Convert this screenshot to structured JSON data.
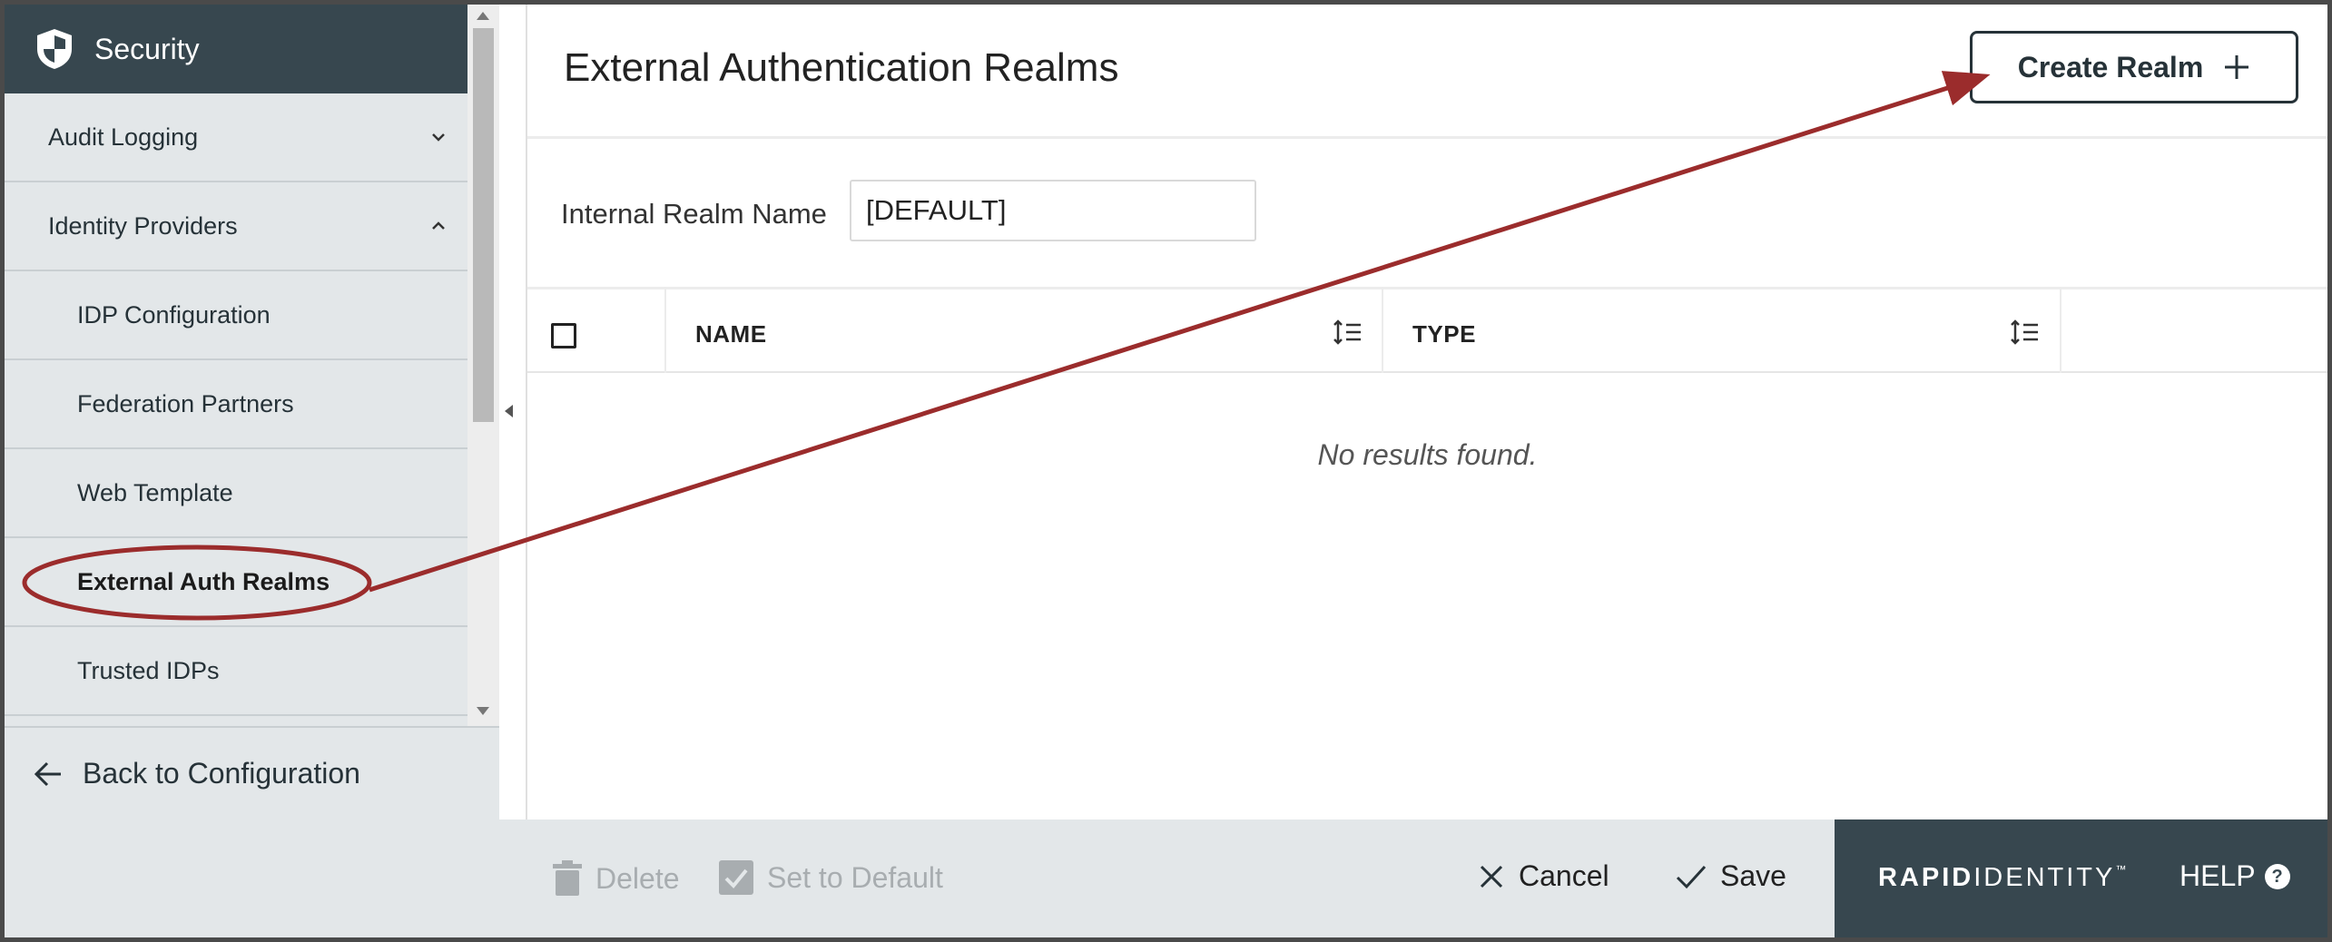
{
  "sidebar": {
    "header_title": "Security",
    "items": [
      {
        "label": "Audit Logging",
        "level": 1,
        "chevron": "down"
      },
      {
        "label": "Identity Providers",
        "level": 1,
        "chevron": "up"
      },
      {
        "label": "IDP Configuration",
        "level": 2
      },
      {
        "label": "Federation Partners",
        "level": 2
      },
      {
        "label": "Web Template",
        "level": 2
      },
      {
        "label": "External Auth Realms",
        "level": 2,
        "active": true
      },
      {
        "label": "Trusted IDPs",
        "level": 2
      }
    ],
    "back_label": "Back to Configuration"
  },
  "main": {
    "title": "External Authentication Realms",
    "create_button_label": "Create Realm",
    "internal_realm": {
      "label": "Internal Realm Name",
      "value": "[DEFAULT]"
    },
    "table": {
      "columns": [
        "NAME",
        "TYPE"
      ],
      "rows": [],
      "empty_message": "No results found."
    }
  },
  "footer": {
    "delete_label": "Delete",
    "set_default_label": "Set to Default",
    "cancel_label": "Cancel",
    "save_label": "Save",
    "brand_bold": "RAPID",
    "brand_light": "IDENTITY",
    "brand_tm": "™",
    "help_label": "HELP",
    "help_glyph": "?"
  },
  "colors": {
    "header_bg": "#37474f",
    "sidebar_bg": "#e3e7e9",
    "annotation": "#9b2c2c"
  },
  "icons": [
    "shield-icon",
    "chevron-down-icon",
    "chevron-up-icon",
    "arrow-left-icon",
    "plus-icon",
    "sort-icon",
    "trash-icon",
    "checkbox-checked-icon",
    "close-icon",
    "check-icon",
    "help-icon"
  ]
}
